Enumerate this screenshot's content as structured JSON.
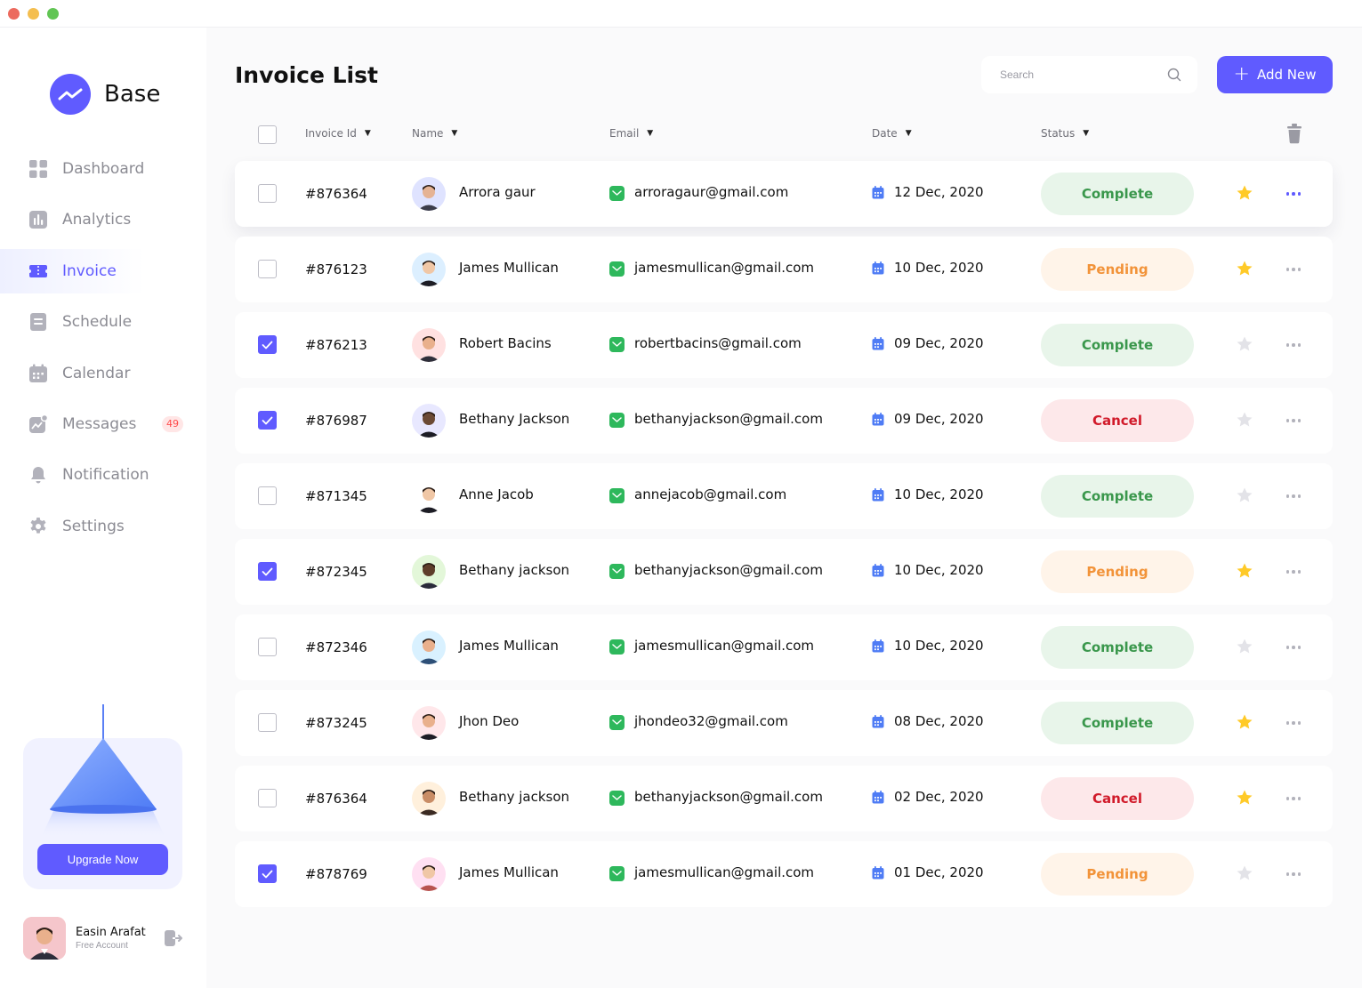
{
  "app": {
    "name": "Base"
  },
  "colors": {
    "accent": "#605bff",
    "complete": "#3a974c",
    "pending": "#f29339",
    "cancel": "#d11a2a",
    "star": "#ffca28"
  },
  "sidebar": {
    "items": [
      {
        "label": "Dashboard",
        "icon": "dashboard-icon"
      },
      {
        "label": "Analytics",
        "icon": "analytics-icon"
      },
      {
        "label": "Invoice",
        "icon": "invoice-icon",
        "active": true
      },
      {
        "label": "Schedule",
        "icon": "schedule-icon"
      },
      {
        "label": "Calendar",
        "icon": "calendar-icon"
      },
      {
        "label": "Messages",
        "icon": "messages-icon",
        "badge": "49"
      },
      {
        "label": "Notification",
        "icon": "bell-icon"
      },
      {
        "label": "Settings",
        "icon": "gear-icon"
      }
    ],
    "upgrade_label": "Upgrade Now",
    "profile": {
      "name": "Easin Arafat",
      "plan": "Free Account"
    }
  },
  "header": {
    "title": "Invoice List",
    "search_placeholder": "Search",
    "add_label": "Add New"
  },
  "table": {
    "columns": [
      "Invoice Id",
      "Name",
      "Email",
      "Date",
      "Status"
    ],
    "rows": [
      {
        "id": "#876364",
        "name": "Arrora gaur",
        "email": "arroragaur@gmail.com",
        "date": "12 Dec, 2020",
        "status": "Complete",
        "checked": false,
        "starred": true
      },
      {
        "id": "#876123",
        "name": "James Mullican",
        "email": "jamesmullican@gmail.com",
        "date": "10 Dec, 2020",
        "status": "Pending",
        "checked": false,
        "starred": true
      },
      {
        "id": "#876213",
        "name": "Robert Bacins",
        "email": "robertbacins@gmail.com",
        "date": "09 Dec, 2020",
        "status": "Complete",
        "checked": true,
        "starred": false
      },
      {
        "id": "#876987",
        "name": "Bethany Jackson",
        "email": "bethanyjackson@gmail.com",
        "date": "09 Dec, 2020",
        "status": "Cancel",
        "checked": true,
        "starred": false
      },
      {
        "id": "#871345",
        "name": "Anne Jacob",
        "email": "annejacob@gmail.com",
        "date": "10 Dec, 2020",
        "status": "Complete",
        "checked": false,
        "starred": false
      },
      {
        "id": "#872345",
        "name": "Bethany jackson",
        "email": "bethanyjackson@gmail.com",
        "date": "10 Dec, 2020",
        "status": "Pending",
        "checked": true,
        "starred": true
      },
      {
        "id": "#872346",
        "name": "James Mullican",
        "email": "jamesmullican@gmail.com",
        "date": "10 Dec, 2020",
        "status": "Complete",
        "checked": false,
        "starred": false
      },
      {
        "id": "#873245",
        "name": "Jhon Deo",
        "email": "jhondeo32@gmail.com",
        "date": "08 Dec, 2020",
        "status": "Complete",
        "checked": false,
        "starred": true
      },
      {
        "id": "#876364",
        "name": "Bethany jackson",
        "email": "bethanyjackson@gmail.com",
        "date": "02 Dec, 2020",
        "status": "Cancel",
        "checked": false,
        "starred": true
      },
      {
        "id": "#878769",
        "name": "James Mullican",
        "email": "jamesmullican@gmail.com",
        "date": "01 Dec, 2020",
        "status": "Pending",
        "checked": true,
        "starred": false
      }
    ]
  }
}
